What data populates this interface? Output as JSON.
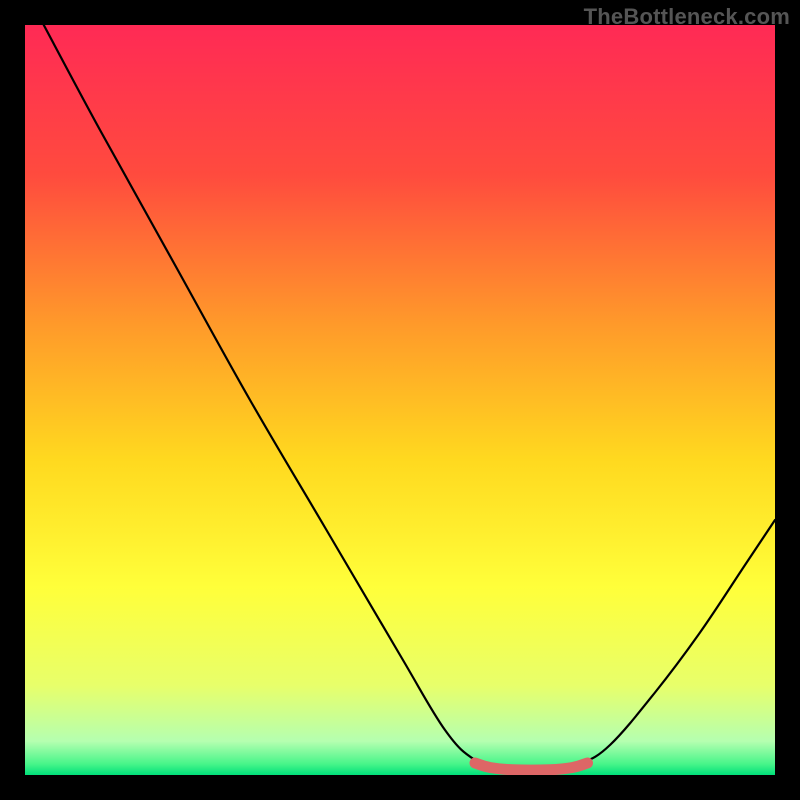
{
  "watermark": "TheBottleneck.com",
  "chart_data": {
    "type": "line",
    "title": "",
    "xlabel": "",
    "ylabel": "",
    "xlim": [
      0,
      100
    ],
    "ylim": [
      0,
      100
    ],
    "grid": false,
    "background_gradient": {
      "stops": [
        {
          "offset": 0.0,
          "color": "#ff2a55"
        },
        {
          "offset": 0.2,
          "color": "#ff4b3e"
        },
        {
          "offset": 0.4,
          "color": "#ff9a2a"
        },
        {
          "offset": 0.58,
          "color": "#ffd91f"
        },
        {
          "offset": 0.75,
          "color": "#ffff3a"
        },
        {
          "offset": 0.88,
          "color": "#e8ff6a"
        },
        {
          "offset": 0.955,
          "color": "#b5ffb0"
        },
        {
          "offset": 0.985,
          "color": "#49f58a"
        },
        {
          "offset": 1.0,
          "color": "#00e07a"
        }
      ]
    },
    "series": [
      {
        "name": "bottleneck-curve",
        "stroke": "#000000",
        "points": [
          {
            "x": 2.5,
            "y": 100
          },
          {
            "x": 10,
            "y": 86
          },
          {
            "x": 20,
            "y": 68
          },
          {
            "x": 30,
            "y": 50
          },
          {
            "x": 40,
            "y": 33
          },
          {
            "x": 50,
            "y": 16
          },
          {
            "x": 56,
            "y": 6
          },
          {
            "x": 60,
            "y": 2
          },
          {
            "x": 64,
            "y": 0.7
          },
          {
            "x": 70,
            "y": 0.7
          },
          {
            "x": 74,
            "y": 1.5
          },
          {
            "x": 78,
            "y": 4
          },
          {
            "x": 84,
            "y": 11
          },
          {
            "x": 90,
            "y": 19
          },
          {
            "x": 96,
            "y": 28
          },
          {
            "x": 100,
            "y": 34
          }
        ]
      },
      {
        "name": "bottom-band",
        "stroke": "#dd6666",
        "points": [
          {
            "x": 60,
            "y": 1.6
          },
          {
            "x": 62,
            "y": 1.0
          },
          {
            "x": 65,
            "y": 0.7
          },
          {
            "x": 70,
            "y": 0.7
          },
          {
            "x": 73,
            "y": 1.0
          },
          {
            "x": 75,
            "y": 1.6
          }
        ]
      }
    ]
  }
}
